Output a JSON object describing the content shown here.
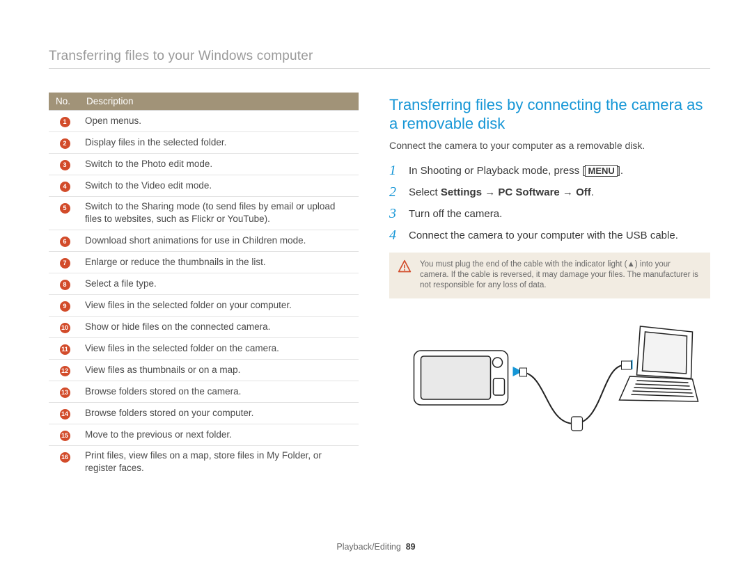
{
  "header": {
    "title": "Transferring files to your Windows computer"
  },
  "table": {
    "head_no": "No.",
    "head_desc": "Description",
    "rows": [
      {
        "n": "1",
        "desc": "Open menus."
      },
      {
        "n": "2",
        "desc": "Display files in the selected folder."
      },
      {
        "n": "3",
        "desc": "Switch to the Photo edit mode."
      },
      {
        "n": "4",
        "desc": "Switch to the Video edit mode."
      },
      {
        "n": "5",
        "desc": "Switch to the Sharing mode (to send files by email or upload files to websites, such as Flickr or YouTube)."
      },
      {
        "n": "6",
        "desc": "Download short animations for use in Children mode."
      },
      {
        "n": "7",
        "desc": "Enlarge or reduce the thumbnails in the list."
      },
      {
        "n": "8",
        "desc": "Select a file type."
      },
      {
        "n": "9",
        "desc": "View files in the selected folder on your computer."
      },
      {
        "n": "10",
        "desc": "Show or hide files on the connected camera."
      },
      {
        "n": "11",
        "desc": "View files in the selected folder on the camera."
      },
      {
        "n": "12",
        "desc": "View files as thumbnails or on a map."
      },
      {
        "n": "13",
        "desc": "Browse folders stored on the camera."
      },
      {
        "n": "14",
        "desc": "Browse folders stored on your computer."
      },
      {
        "n": "15",
        "desc": "Move to the previous or next folder."
      },
      {
        "n": "16",
        "desc": "Print files, view files on a map, store files in My Folder, or register faces."
      }
    ]
  },
  "section": {
    "title": "Transferring files by connecting the camera as a removable disk",
    "intro": "Connect the camera to your computer as a removable disk.",
    "steps": [
      {
        "n": "1",
        "pre": "In Shooting or Playback mode, press [",
        "key": "MENU",
        "post": "]."
      },
      {
        "n": "2",
        "select_label": "Select ",
        "path1": "Settings",
        "arrow1": " → ",
        "path2": "PC Software",
        "arrow2": " → ",
        "path3": "Off",
        "end": "."
      },
      {
        "n": "3",
        "text": "Turn off the camera."
      },
      {
        "n": "4",
        "text": "Connect the camera to your computer with the USB cable."
      }
    ],
    "note": "You must plug the end of the cable with the indicator light (▲) into your camera. If the cable is reversed, it may damage your files. The manufacturer is not responsible for any loss of data."
  },
  "footer": {
    "section": "Playback/Editing",
    "page": "89"
  }
}
